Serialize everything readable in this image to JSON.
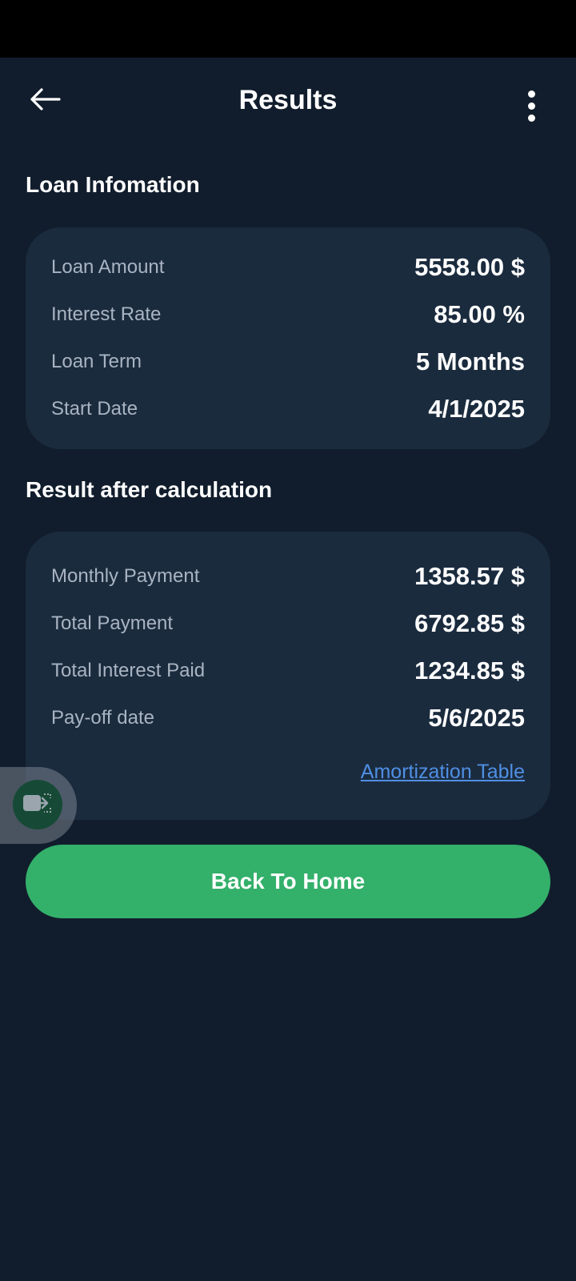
{
  "header": {
    "title": "Results",
    "back_icon": "arrow-left-icon",
    "menu_icon": "more-vertical-icon"
  },
  "loan_info": {
    "title": "Loan Infomation",
    "rows": [
      {
        "label": "Loan Amount",
        "value": "5558.00 $"
      },
      {
        "label": "Interest Rate",
        "value": "85.00 %"
      },
      {
        "label": "Loan Term",
        "value": "5 Months"
      },
      {
        "label": "Start Date",
        "value": "4/1/2025"
      }
    ]
  },
  "results": {
    "title": "Result after calculation",
    "rows": [
      {
        "label": "Monthly Payment",
        "value": "1358.57 $"
      },
      {
        "label": "Total Payment",
        "value": "6792.85 $"
      },
      {
        "label": "Total Interest Paid",
        "value": "1234.85 $"
      },
      {
        "label": "Pay-off date",
        "value": "5/6/2025"
      }
    ],
    "amortization_link": "Amortization Table"
  },
  "home_button": {
    "label": "Back To Home"
  },
  "floating_button": {
    "icon": "screen-share-icon"
  },
  "colors": {
    "background": "#111d2c",
    "card": "#1b2b3e",
    "accent_green": "#33b06a",
    "link_blue": "#4f8fe4"
  }
}
